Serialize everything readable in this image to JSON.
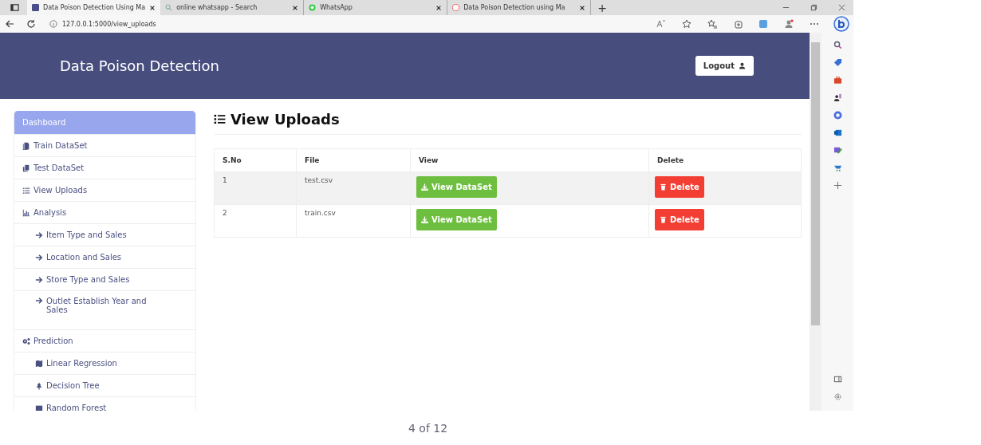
{
  "browser": {
    "tabs": [
      {
        "title": "Data Poison Detection Using Ma",
        "selected": true
      },
      {
        "title": "online whatsapp - Search",
        "selected": false
      },
      {
        "title": "WhatsApp",
        "selected": false
      },
      {
        "title": "Data Poison Detection using Ma",
        "selected": false
      }
    ],
    "new_tab": "+",
    "address": "127.0.0.1:5000/view_uploads"
  },
  "header": {
    "title": "Data Poison Detection",
    "logout": "Logout"
  },
  "sidebar": {
    "items": [
      {
        "label": "Dashboard",
        "selected": true
      },
      {
        "label": "Train DataSet",
        "selected": false
      },
      {
        "label": "Test DataSet",
        "selected": false
      },
      {
        "label": "View Uploads",
        "selected": false
      },
      {
        "label": "Analysis",
        "selected": false,
        "children": [
          {
            "label": "Item Type and Sales",
            "selected": false
          },
          {
            "label": "Location and Sales",
            "selected": false
          },
          {
            "label": "Store Type and Sales",
            "selected": false
          },
          {
            "label": "Outlet Establish Year and Sales",
            "selected": false
          }
        ]
      },
      {
        "label": "Prediction",
        "selected": false,
        "children": [
          {
            "label": "Linear Regression",
            "selected": false
          },
          {
            "label": "Decision Tree",
            "selected": false
          },
          {
            "label": "Random Forest",
            "selected": false
          }
        ]
      }
    ]
  },
  "main": {
    "heading": "View Uploads",
    "table": {
      "columns": [
        "S.No",
        "File",
        "View",
        "Delete"
      ],
      "rows": [
        {
          "sno": "1",
          "file": "test.csv",
          "view": "View DataSet",
          "delete": "Delete"
        },
        {
          "sno": "2",
          "file": "train.csv",
          "view": "View DataSet",
          "delete": "Delete"
        }
      ]
    }
  },
  "footer": {
    "page": "4 of 12"
  }
}
